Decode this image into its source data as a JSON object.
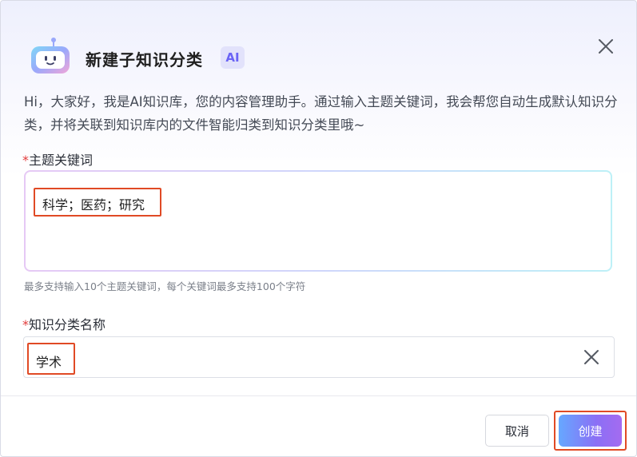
{
  "dialog": {
    "title": "新建子知识分类",
    "ai_badge": "AI",
    "intro": "Hi，大家好，我是AI知识库，您的内容管理助手。通过输入主题关键词，我会帮您自动生成默认知识分类，并将关联到知识库内的文件智能归类到知识分类里哦~"
  },
  "keywords": {
    "required_mark": "*",
    "label": "主题关键词",
    "value": "科学；医药；研究",
    "hint": "最多支持输入10个主题关键词，每个关键词最多支持100个字符"
  },
  "category_name": {
    "required_mark": "*",
    "label": "知识分类名称",
    "value": "学术"
  },
  "footer": {
    "cancel_label": "取消",
    "create_label": "创建"
  },
  "colors": {
    "accent_purple": "#8b6ff5",
    "highlight_red": "#e04a25",
    "required_red": "#e23c3c"
  }
}
